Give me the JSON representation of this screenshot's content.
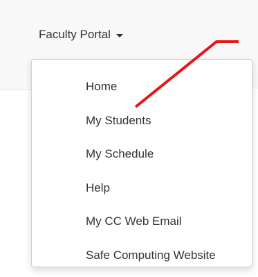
{
  "nav": {
    "toggle_label": "Faculty Portal",
    "caret_icon": "caret-down-icon"
  },
  "menu": {
    "items": [
      {
        "label": "Home"
      },
      {
        "label": "My Students"
      },
      {
        "label": "My Schedule"
      },
      {
        "label": "Help"
      },
      {
        "label": "My CC Web Email"
      },
      {
        "label": "Safe Computing Website"
      }
    ]
  },
  "annotation": {
    "color": "#e8141b",
    "icon": "red-pointer-line"
  }
}
